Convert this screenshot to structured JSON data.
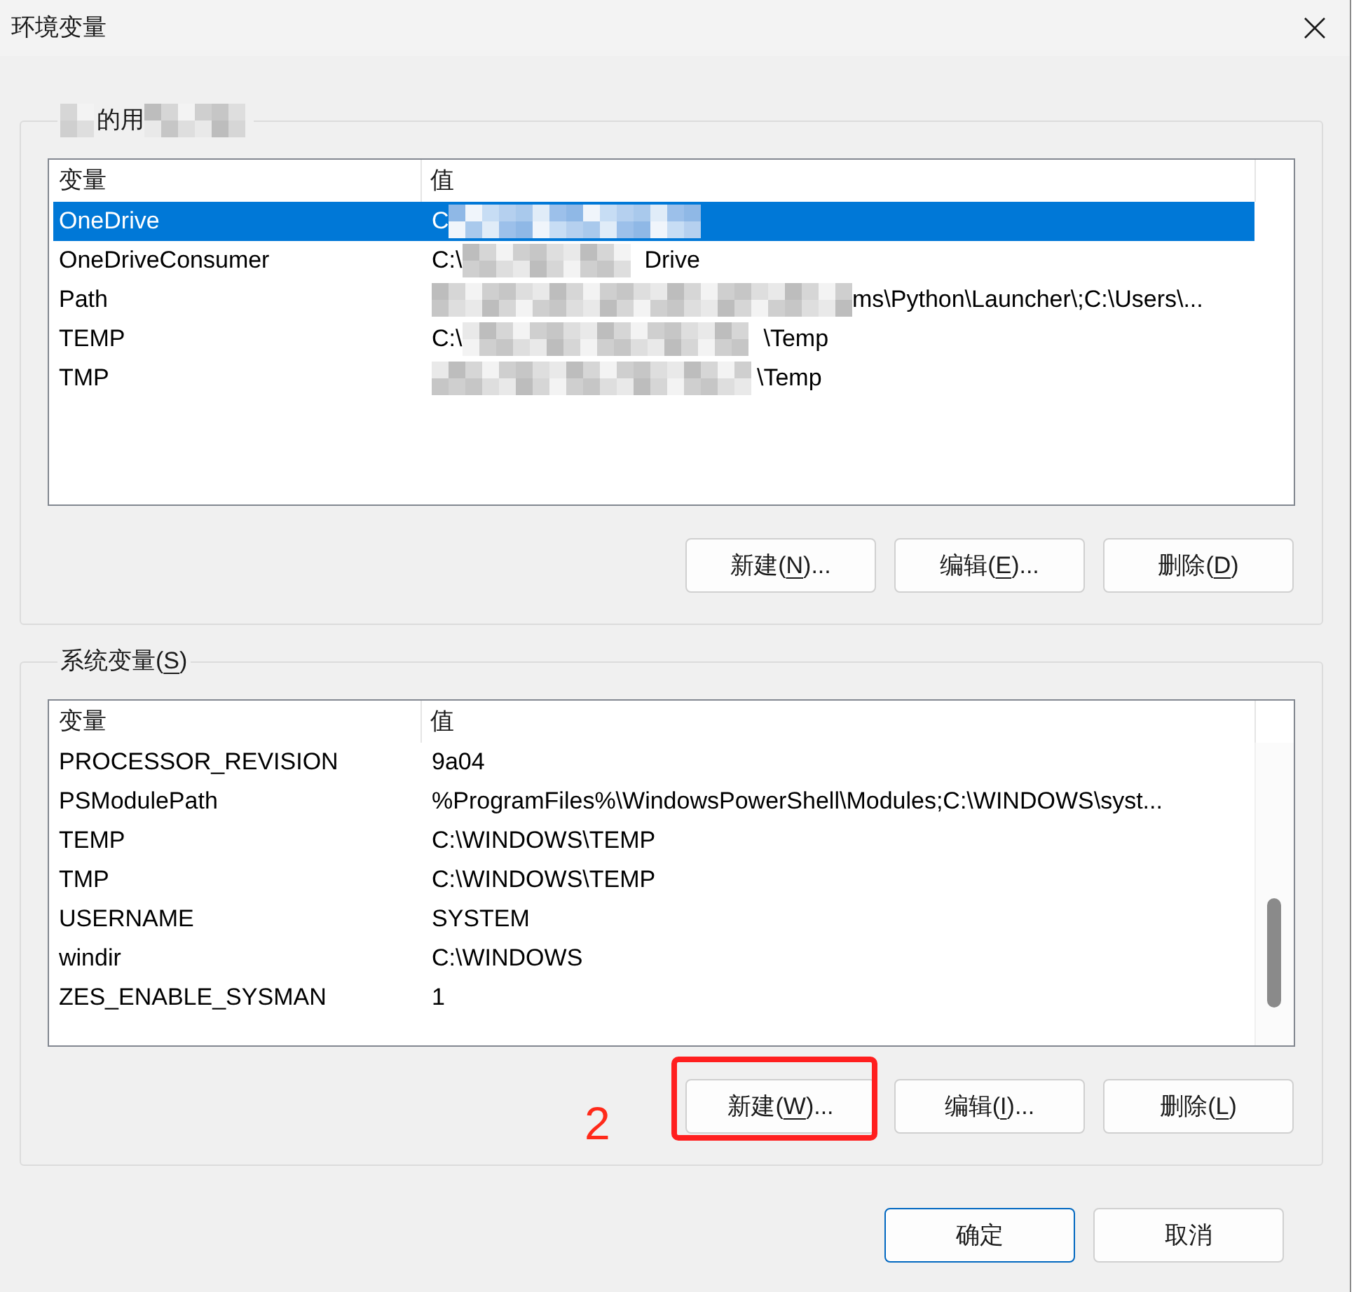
{
  "window": {
    "title": "环境变量"
  },
  "user_group": {
    "title": [
      {
        "kind": "redacted"
      },
      {
        "kind": "text",
        "text": "的用"
      },
      {
        "kind": "redacted"
      }
    ],
    "columns": [
      "变量",
      "值"
    ],
    "scrollbar": false,
    "rows": [
      {
        "name": "OneDrive",
        "value": [
          {
            "kind": "text",
            "text": "C"
          },
          {
            "kind": "redacted"
          }
        ],
        "selected": true
      },
      {
        "name": "OneDriveConsumer",
        "value": [
          {
            "kind": "text",
            "text": "C:\\"
          },
          {
            "kind": "redacted"
          },
          {
            "kind": "text",
            "text": "Drive"
          }
        ],
        "selected": false
      },
      {
        "name": "Path",
        "value": [
          {
            "kind": "redacted"
          },
          {
            "kind": "text",
            "text": "ms\\Python\\Launcher\\;C:\\Users\\..."
          }
        ],
        "selected": false
      },
      {
        "name": "TEMP",
        "value": [
          {
            "kind": "text",
            "text": "C:\\"
          },
          {
            "kind": "redacted"
          },
          {
            "kind": "text",
            "text": "\\Temp"
          }
        ],
        "selected": false
      },
      {
        "name": "TMP",
        "value": [
          {
            "kind": "redacted"
          },
          {
            "kind": "text",
            "text": "\\Temp"
          }
        ],
        "selected": false
      }
    ],
    "buttons": [
      {
        "label": {
          "before": "新建(",
          "key": "N",
          "after": ")..."
        },
        "highlighted": false
      },
      {
        "label": {
          "before": "编辑(",
          "key": "E",
          "after": ")..."
        },
        "highlighted": false
      },
      {
        "label": {
          "before": "删除(",
          "key": "D",
          "after": ")"
        },
        "highlighted": false
      }
    ]
  },
  "system_group": {
    "title": {
      "before": "系统变量(",
      "key": "S",
      "after": ")"
    },
    "columns": [
      "变量",
      "值"
    ],
    "scrollbar": true,
    "rows": [
      {
        "name": "PROCESSOR_REVISION",
        "value": "9a04",
        "selected": false
      },
      {
        "name": "PSModulePath",
        "value": "%ProgramFiles%\\WindowsPowerShell\\Modules;C:\\WINDOWS\\syst...",
        "selected": false
      },
      {
        "name": "TEMP",
        "value": "C:\\WINDOWS\\TEMP",
        "selected": false
      },
      {
        "name": "TMP",
        "value": "C:\\WINDOWS\\TEMP",
        "selected": false
      },
      {
        "name": "USERNAME",
        "value": "SYSTEM",
        "selected": false
      },
      {
        "name": "windir",
        "value": "C:\\WINDOWS",
        "selected": false
      },
      {
        "name": "ZES_ENABLE_SYSMAN",
        "value": "1",
        "selected": false
      }
    ],
    "buttons": [
      {
        "label": {
          "before": "新建(",
          "key": "W",
          "after": ")..."
        },
        "highlighted": true
      },
      {
        "label": {
          "before": "编辑(",
          "key": "I",
          "after": ")..."
        },
        "highlighted": false
      },
      {
        "label": {
          "before": "删除(",
          "key": "L",
          "after": ")"
        },
        "highlighted": false
      }
    ]
  },
  "annotation": {
    "label": "2"
  },
  "dialog_buttons": [
    {
      "label": {
        "before": "确定"
      },
      "default": true
    },
    {
      "label": {
        "before": "取消"
      },
      "default": false
    }
  ]
}
